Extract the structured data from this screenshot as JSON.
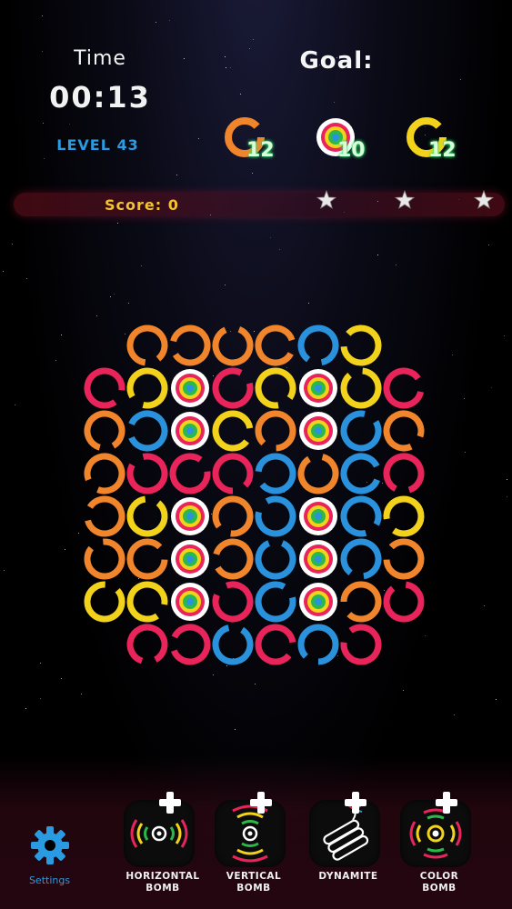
{
  "header": {
    "time_label": "Time",
    "time_value": "00:13",
    "level_label": "LEVEL 43",
    "goal_label": "Goal:"
  },
  "goals": [
    {
      "color": "#f0852b",
      "icon": "orange-ring-icon",
      "count": "12"
    },
    {
      "color": "#ffffff",
      "icon": "target-ring-icon",
      "count": "10"
    },
    {
      "color": "#f2d21a",
      "icon": "yellow-ring-icon",
      "count": "12"
    }
  ],
  "score": {
    "label": "Score:  0",
    "stars": [
      "star-icon",
      "star-icon",
      "star-icon"
    ]
  },
  "board": {
    "palette": {
      "O": "#f0852b",
      "Y": "#f2d21a",
      "R": "#e8245a",
      "B": "#2a92dc",
      "T": "target"
    },
    "rows": [
      "-OOOOBY-",
      "RYTRYTYR",
      "OBTYOTBO",
      "ORRRBOBR",
      "OYTOBTBY",
      "OOTOBTBO",
      "YYTRBTOR",
      "-RRBRBR-"
    ]
  },
  "bottom": {
    "settings_label": "Settings",
    "boosters": [
      {
        "line1": "HORIZONTAL",
        "line2": "BOMB",
        "icon": "horizontal-bomb-icon"
      },
      {
        "line1": "VERTICAL",
        "line2": "BOMB",
        "icon": "vertical-bomb-icon"
      },
      {
        "line1": "DYNAMITE",
        "line2": "",
        "icon": "dynamite-icon"
      },
      {
        "line1": "COLOR",
        "line2": "BOMB",
        "icon": "color-bomb-icon"
      }
    ]
  }
}
